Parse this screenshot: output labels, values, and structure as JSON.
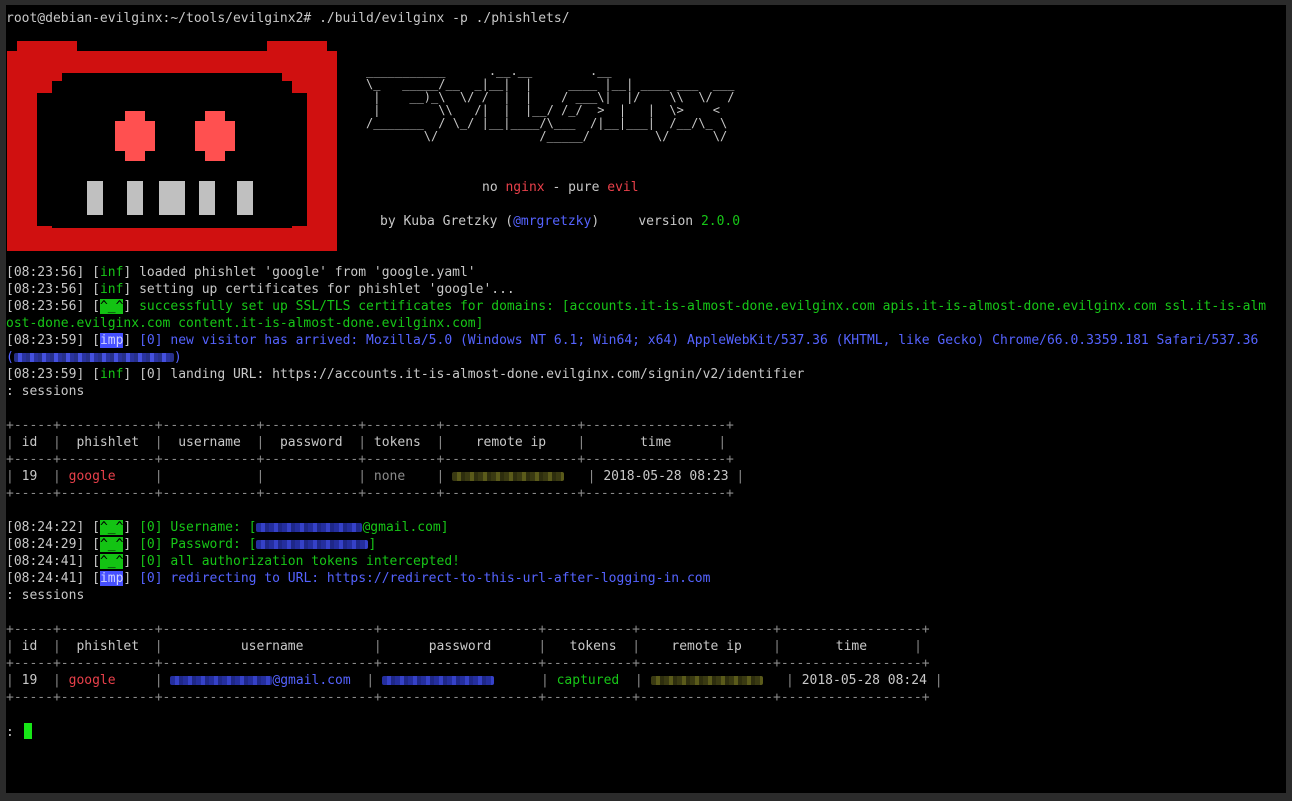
{
  "prompt": "root@debian-evilginx:~/tools/evilginx2# ./build/evilginx -p ./phishlets/",
  "banner": {
    "ascii": "___________      .__.__        .__\n\\_   _____/__  _|__|  |     ____ |__| ____ ___  ___\n |    __)_\\  \\/ /  |  |    / ___\\|  |/    \\\\  \\/  /\n |        \\\\   /|  |  |__/ /_/  >  |   |  \\>    <\n/_______  / \\_/ |__|____/\\___  /|__|___|  /__/\\_ \\\n        \\/              /_____/         \\/      \\/",
    "tagline_no": "no",
    "tagline_nginx": "nginx",
    "tagline_dash": "-",
    "tagline_pure": "pure",
    "tagline_evil": "evil",
    "by": "by Kuba Gretzky (",
    "handle": "@mrgretzky",
    "by_close": ")",
    "version_label": "version",
    "version": "2.0.0"
  },
  "log1": [
    {
      "ts": "[08:23:56]",
      "tag": "inf",
      "msg": "loaded phishlet 'google' from 'google.yaml'"
    },
    {
      "ts": "[08:23:56]",
      "tag": "inf",
      "msg": "setting up certificates for phishlet 'google'..."
    },
    {
      "ts": "[08:23:56]",
      "tag": "^_^",
      "msg": "successfully set up SSL/TLS certificates for domains: [accounts.it-is-almost-done.evilginx.com apis.it-is-almost-done.evilginx.com ssl.it-is-alm",
      "cont": "ost-done.evilginx.com content.it-is-almost-done.evilginx.com]"
    },
    {
      "ts": "[08:23:59]",
      "tag": "imp",
      "msg": "[0] new visitor has arrived: Mozilla/5.0 (Windows NT 6.1; Win64; x64) AppleWebKit/537.36 (KHTML, like Gecko) Chrome/66.0.3359.181 Safari/537.36",
      "cont_open": "(",
      "cont_close": ")"
    },
    {
      "ts": "[08:23:59]",
      "tag": "inf",
      "msg": "[0] landing URL: https://accounts.it-is-almost-done.evilginx.com/signin/v2/identifier"
    }
  ],
  "sessions_cmd": ": sessions",
  "table1": {
    "headers": [
      "id",
      "phishlet",
      "username",
      "password",
      "tokens",
      "remote ip",
      "time"
    ],
    "row": {
      "id": "19",
      "phishlet": "google",
      "username": "",
      "password": "",
      "tokens": "none",
      "time": "2018-05-28 08:23"
    }
  },
  "log2": [
    {
      "ts": "[08:24:22]",
      "tag": "^_^",
      "msg": "[0] Username: [",
      "suffix": "@gmail.com]"
    },
    {
      "ts": "[08:24:29]",
      "tag": "^_^",
      "msg": "[0] Password: [",
      "suffix": "]"
    },
    {
      "ts": "[08:24:41]",
      "tag": "^_^",
      "msg": "[0] all authorization tokens intercepted!"
    },
    {
      "ts": "[08:24:41]",
      "tag": "imp",
      "msg": "[0] redirecting to URL: https://redirect-to-this-url-after-logging-in.com"
    }
  ],
  "table2": {
    "headers": [
      "id",
      "phishlet",
      "username",
      "password",
      "tokens",
      "remote ip",
      "time"
    ],
    "row": {
      "id": "19",
      "phishlet": "google",
      "username_suffix": "@gmail.com",
      "tokens": "captured",
      "time": "2018-05-28 08:24"
    }
  },
  "prompt_char": ":",
  "colors": {
    "info": "#c8c8c8",
    "success": "#17c617",
    "important": "#5563ff",
    "accent_red": "#e8404a",
    "skull_red": "#d01010"
  }
}
